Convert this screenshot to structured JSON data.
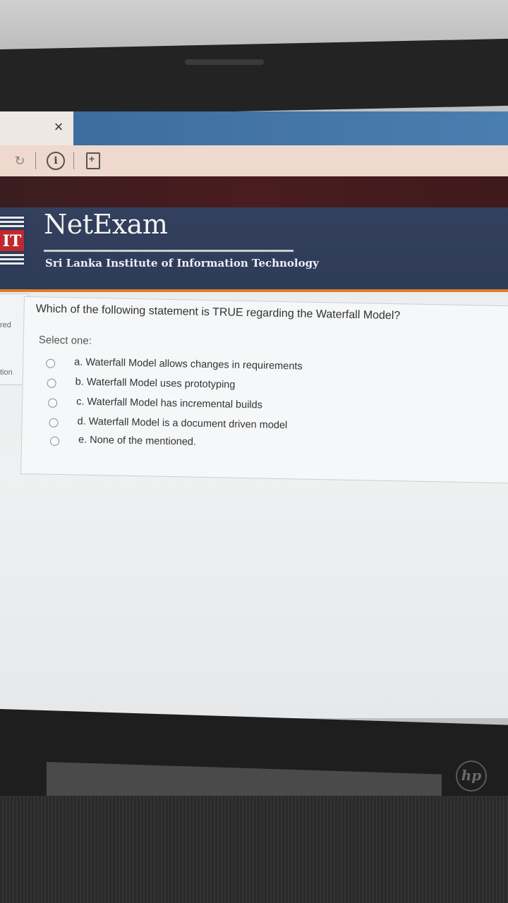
{
  "browser": {
    "close_tab_glyph": "×",
    "icons": [
      "reload-icon",
      "info-icon",
      "page-icon"
    ]
  },
  "header": {
    "logo_text": "IT",
    "title": "NetExam",
    "subtitle": "Sri Lanka Institute of Information Technology"
  },
  "sidebar": {
    "item_a": "red",
    "item_b": "tion"
  },
  "question": {
    "text": "Which of the following statement is TRUE regarding the Waterfall Model?",
    "prompt": "Select one:",
    "options": [
      {
        "label": "a. Waterfall Model allows changes in requirements",
        "selected": false
      },
      {
        "label": "b. Waterfall Model uses prototyping",
        "selected": false
      },
      {
        "label": "c. Waterfall Model has incremental builds",
        "selected": false
      },
      {
        "label": "d. Waterfall Model is a document driven model",
        "selected": false
      },
      {
        "label": "e. None of the mentioned.",
        "selected": false
      }
    ]
  },
  "device": {
    "brand_logo": "hp"
  },
  "colors": {
    "header_bg": "#2e3b58",
    "accent_line": "#e07b2a",
    "dark_band": "#4a1c1f"
  }
}
